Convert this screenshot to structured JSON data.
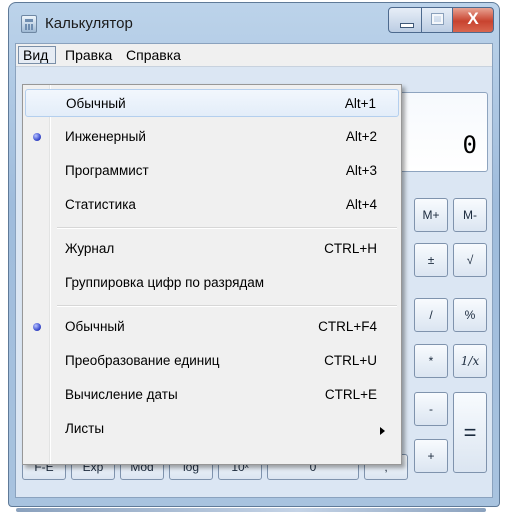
{
  "window": {
    "title": "Калькулятор",
    "close_glyph": "X"
  },
  "menubar": {
    "view": "Вид",
    "edit": "Правка",
    "help": "Справка"
  },
  "display": {
    "value": "0"
  },
  "keys": {
    "m_plus": "M+",
    "m_minus": "M-",
    "plus_minus": "±",
    "sqrt": "√",
    "divide": "/",
    "percent": "%",
    "multiply": "*",
    "reciprocal": "1/x",
    "subtract": "-",
    "add": "+",
    "equals": "=",
    "bottom_partial": [
      "F-E",
      "Exp",
      "Mod",
      "log",
      "10ˣ",
      "0",
      ","
    ]
  },
  "view_menu": {
    "items": [
      {
        "label": "Обычный",
        "shortcut": "Alt+1",
        "highlighted": true,
        "checked": false
      },
      {
        "label": "Инженерный",
        "shortcut": "Alt+2",
        "checked": true
      },
      {
        "label": "Программист",
        "shortcut": "Alt+3",
        "checked": false
      },
      {
        "label": "Статистика",
        "shortcut": "Alt+4",
        "checked": false
      },
      {
        "label": "Журнал",
        "shortcut": "CTRL+H",
        "checked": false
      },
      {
        "label": "Группировка цифр по разрядам",
        "shortcut": "",
        "checked": false
      },
      {
        "label": "Обычный",
        "shortcut": "CTRL+F4",
        "checked": true
      },
      {
        "label": "Преобразование единиц",
        "shortcut": "CTRL+U",
        "checked": false
      },
      {
        "label": "Вычисление даты",
        "shortcut": "CTRL+E",
        "checked": false
      },
      {
        "label": "Листы",
        "shortcut": "",
        "submenu": true,
        "checked": false
      }
    ]
  },
  "colors": {
    "menu_bg": "#f0f0f0",
    "highlight": "#e3edf9",
    "radio": "#3d4ed0",
    "close_button": "#c8432f"
  }
}
